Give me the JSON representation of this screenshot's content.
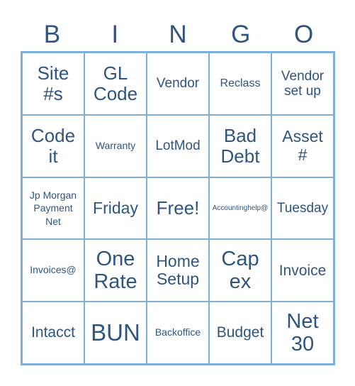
{
  "header": {
    "letters": [
      "B",
      "I",
      "N",
      "G",
      "O"
    ]
  },
  "colors": {
    "text": "#2e5580",
    "border": "#7fafd6",
    "background": "#ffffff"
  },
  "cells": [
    [
      "Site #s",
      "GL Code",
      "Vendor",
      "Reclass",
      "Vendor set up"
    ],
    [
      "Code it",
      "Warranty",
      "LotMod",
      "Bad Debt",
      "Asset #"
    ],
    [
      "Jp Morgan Payment Net",
      "Friday",
      "Free!",
      "Accountinghelp@",
      "Tuesday"
    ],
    [
      "Invoices@",
      "One Rate",
      "Home Setup",
      "Cap ex",
      "Invoice"
    ],
    [
      "Intacct",
      "BUN",
      "Backoffice",
      "Budget",
      "Net 30"
    ]
  ]
}
